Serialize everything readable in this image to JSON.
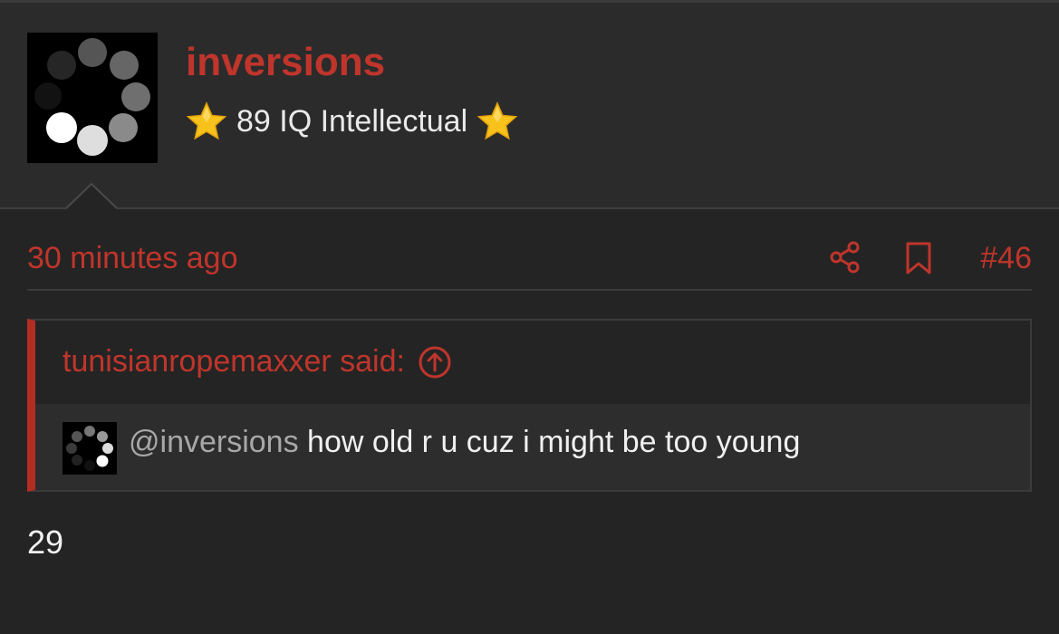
{
  "post": {
    "author": {
      "username": "inversions",
      "title_text": "89 IQ Intellectual",
      "title_icons": [
        "star-icon",
        "star-icon"
      ],
      "avatar": "loading-spinner-avatar"
    },
    "meta": {
      "timestamp": "30 minutes ago",
      "share_icon": "share-icon",
      "bookmark_icon": "bookmark-icon",
      "post_number": "#46"
    },
    "quote": {
      "author_label": "tunisianropemaxxer said:",
      "jump_icon": "arrow-up-circle-icon",
      "mention": "@inversions",
      "text": " how old r u cuz i might be too young"
    },
    "body": "29"
  },
  "colors": {
    "accent": "#c0352b",
    "background": "#242424",
    "header_background": "#2b2b2b",
    "text": "#f2f2f2"
  }
}
